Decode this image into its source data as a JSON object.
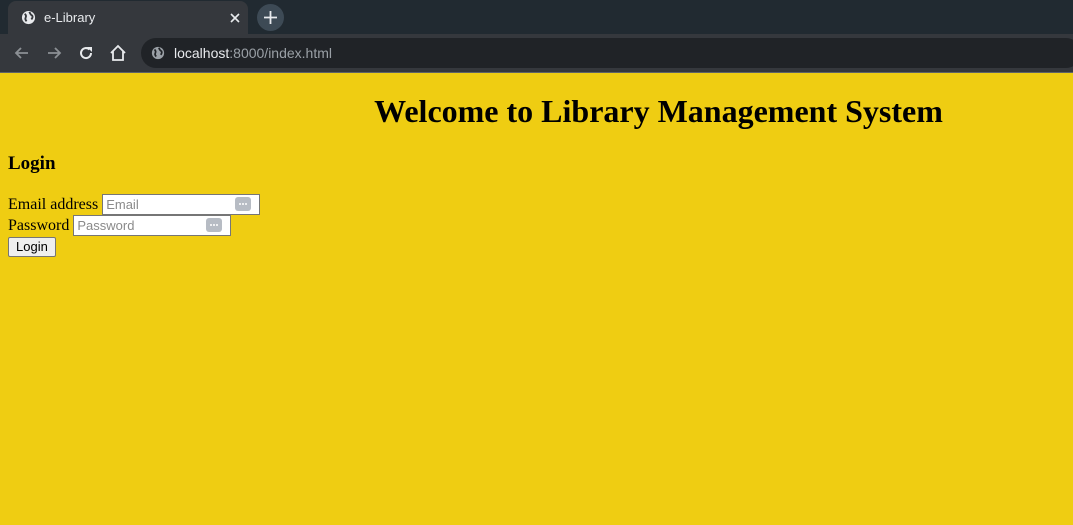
{
  "browser": {
    "tab_title": "e-Library",
    "url_host": "localhost",
    "url_rest": ":8000/index.html"
  },
  "page": {
    "title": "Welcome to Library Management System",
    "login_heading": "Login",
    "email": {
      "label": "Email address",
      "placeholder": "Email",
      "value": ""
    },
    "password": {
      "label": "Password",
      "placeholder": "Password",
      "value": ""
    },
    "login_button": "Login"
  },
  "colors": {
    "page_background": "#efcd12",
    "chrome_dark": "#212a31",
    "chrome_toolbar": "#35383d"
  }
}
